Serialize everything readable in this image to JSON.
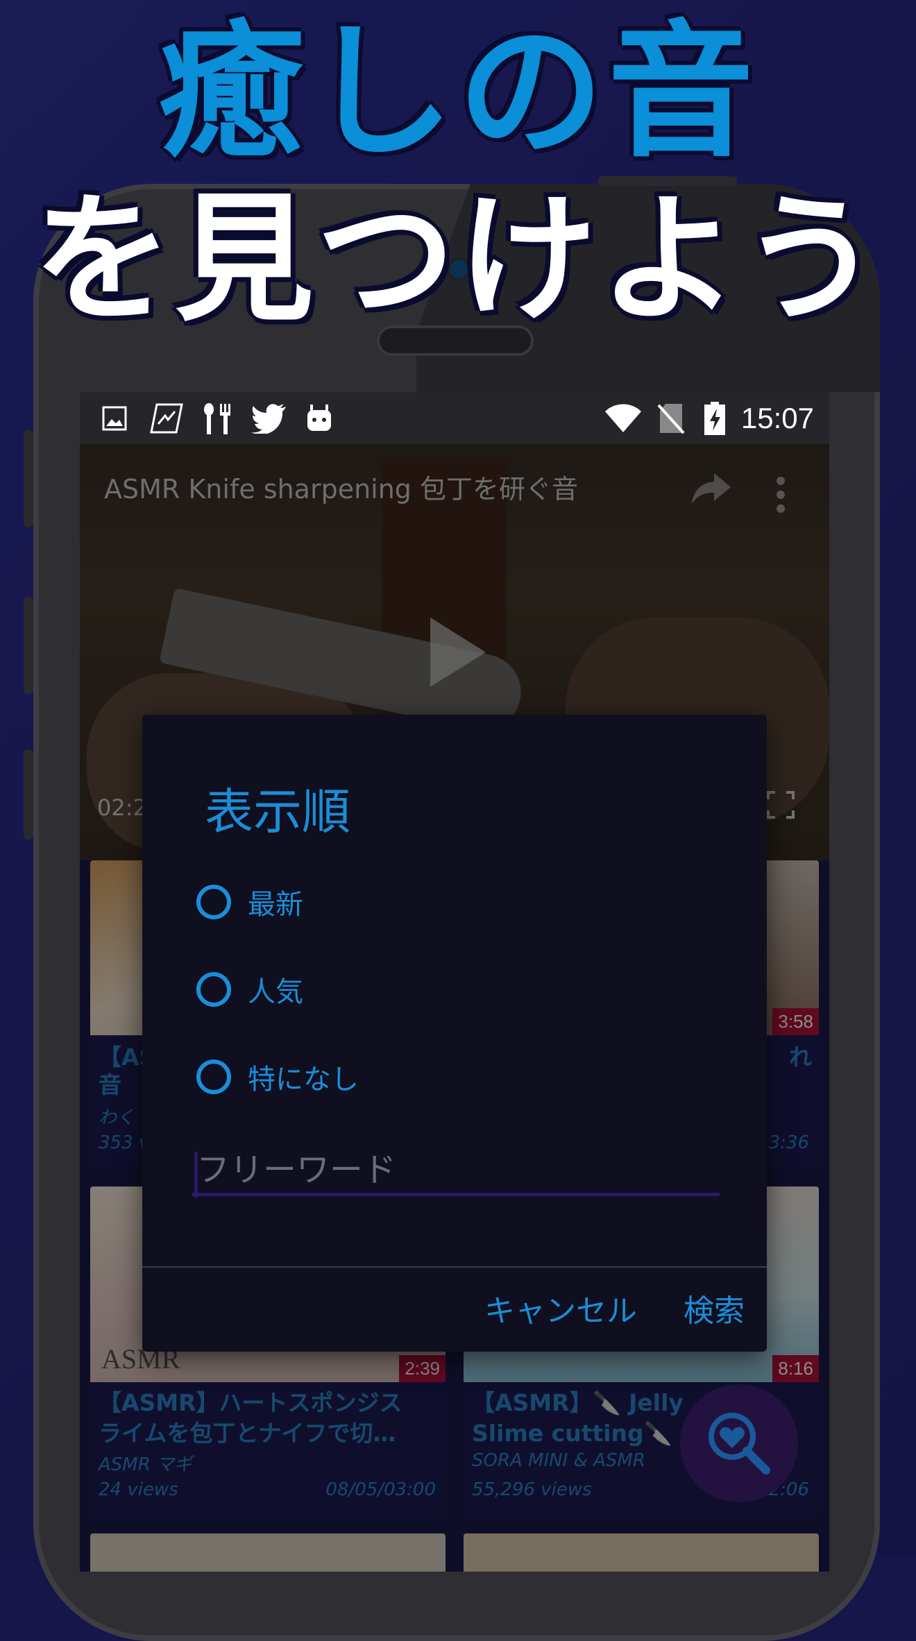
{
  "promo": {
    "headline_line1": "癒しの音",
    "headline_line2": "を見つけよう"
  },
  "status_bar": {
    "left_icons": [
      "image-icon",
      "signal-app-icon",
      "cutlery-icon",
      "twitter-icon",
      "android-icon"
    ],
    "right_icons": [
      "wifi-icon",
      "no-sim-icon",
      "battery-charging-icon"
    ],
    "time": "15:07"
  },
  "video": {
    "title": "ASMR Knife sharpening 包丁を研ぐ音",
    "elapsed": "02:2"
  },
  "cards": [
    {
      "title": "【AS",
      "title2": "音",
      "author": "わく",
      "views": "353 v",
      "date": "",
      "duration": ""
    },
    {
      "title": "れ",
      "title2": "",
      "author": "",
      "views": "",
      "date": "3:36",
      "duration": "3:58"
    },
    {
      "title": "【ASMR】ハートスポンジス",
      "title2": "ライムを包丁とナイフで切…",
      "author": "ASMR マギ",
      "views": "24 views",
      "date": "08/05/03:00",
      "duration": "2:39",
      "thumb_text": "ASMR"
    },
    {
      "title": "【ASMR】🔪 Jelly",
      "title2": "Slime cutting🔪",
      "author": "SORA MINI & ASMR",
      "views": "55,296 views",
      "date": "08/  , 12:06",
      "duration": "8:16"
    }
  ],
  "dialog": {
    "title": "表示順",
    "options": [
      "最新",
      "人気",
      "特になし"
    ],
    "search_placeholder": "フリーワード",
    "search_value": "",
    "cancel_label": "キャンセル",
    "search_label": "検索"
  },
  "colors": {
    "accent": "#1a8ed8",
    "background": "#16164a",
    "dialog_bg": "#0f0f1f",
    "duration_badge": "#b0123a"
  }
}
